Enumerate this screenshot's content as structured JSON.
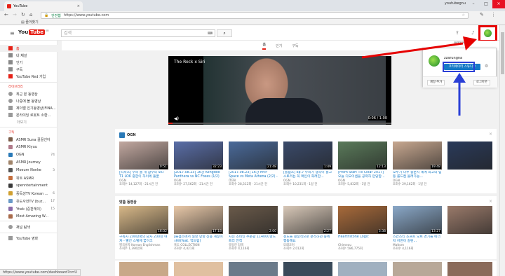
{
  "browser": {
    "tab_title": "YouTube",
    "user_label": "youtubegnu",
    "url_secure": "안전함",
    "url": "https://www.youtube.com",
    "bookmarks_label": "즐겨찾기"
  },
  "header": {
    "logo_you": "You",
    "logo_tube": "Tube",
    "logo_region": "KR",
    "search_placeholder": "검색",
    "keyboard_label": "⌨"
  },
  "tabs": [
    {
      "label": "홈"
    },
    {
      "label": "인기"
    },
    {
      "label": "구독"
    }
  ],
  "sidebar": {
    "items": [
      {
        "label": "홈",
        "color": "#e62117"
      },
      {
        "label": "내 채널",
        "color": "#888888"
      },
      {
        "label": "인기",
        "color": "#888888"
      },
      {
        "label": "구독",
        "color": "#888888"
      },
      {
        "label": "YouTube Red 가입",
        "color": "#e62117"
      }
    ],
    "library_header": "라이브러리",
    "library": [
      {
        "label": "최근 본 동영상"
      },
      {
        "label": "나중에 볼 동영상"
      },
      {
        "label": "제이벨 인기동영상(FINA..."
      },
      {
        "label": "몬라이딩 로봇트 소환..."
      }
    ],
    "library_more": "더보기",
    "subs_header": "구독",
    "subscriptions": [
      {
        "label": "ASMR Suna 꿀꿀선아",
        "count": "",
        "color": "#7a5c48"
      },
      {
        "label": "ASMR Kiyuu",
        "count": "",
        "color": "#b07a8a"
      },
      {
        "label": "OGN",
        "count": "74",
        "color": "#2a7ab8"
      },
      {
        "label": "ASMR Journey",
        "count": "",
        "color": "#a0846a"
      },
      {
        "label": "Moeum Nonke",
        "count": "3",
        "color": "#555555"
      },
      {
        "label": "위트 ASMR",
        "count": "",
        "color": "#c47040"
      },
      {
        "label": "spenntertainment",
        "count": "",
        "color": "#3a3a3a"
      },
      {
        "label": "중독성TV Korean ...",
        "count": "6",
        "color": "#d0a030"
      },
      {
        "label": "유도사전TV (buz...",
        "count": "17",
        "color": "#6a9ac8"
      },
      {
        "label": "Ytwk (중판계이)",
        "count": "15",
        "color": "#8a6aa8"
      },
      {
        "label": "Most Amazing W...",
        "count": "",
        "color": "#a86a4a"
      }
    ],
    "browse_channels": "채널 탐색",
    "movies": "YouTube 영화"
  },
  "player": {
    "title": "The Rock x Siri",
    "time": "0:06 / 1:00",
    "progress": 0.02
  },
  "ogn_section": {
    "title": "OGN",
    "cards": [
      {
        "title": "[티쳐스] 우리 둘 개 참우의 SKT T1 LOK 중한이 하이에 둘꿈",
        "channel": "OGN",
        "meta": "조회수 14,127회 · 21시간 전",
        "duration": "0:51",
        "color": "#c2a8a0"
      },
      {
        "title": "[2017.08.23] 16강 Kongdoo Panthera vs NC Foxes (1/2)",
        "channel": "OGN",
        "meta": "조회수 27,562회 · 21시간 전",
        "duration": "32:23",
        "color": "#5a6ea8"
      },
      {
        "title": "[2017.08.23] 16강 MVP Space vs Meta Athena (2/2) - 오버...",
        "channel": "OGN",
        "meta": "조회수 28,312회 · 21시간 전",
        "duration": "21:48",
        "color": "#4a6a9a"
      },
      {
        "title": "[롤챔스] Ep.7 우리가 생각이 들고스토리는 꼭 확인이 화려한...",
        "channel": "OGN",
        "meta": "조회수 10,231회 · 1일 전",
        "duration": "1:49",
        "color": "#3a4a6a"
      },
      {
        "title": "[From Start Till Clear 2017] 오늘 디오이셉을 공략하 만당합...",
        "channel": "OGN",
        "meta": "조회수 5,832회 · 1일 전",
        "duration": "12:13",
        "color": "#5a7a5a"
      },
      {
        "title": "오두기 다주 중분시 셰계 최고의 팀 등 롤드컵 몰려가능...",
        "channel": "OGN",
        "meta": "조회수 29,162회 · 1일 전",
        "duration": "19:48",
        "color": "#c8a890"
      },
      {
        "title": "",
        "channel": "",
        "meta": "",
        "duration": "",
        "color": "#2a3a5a"
      }
    ]
  },
  "rec_section": {
    "title": "맞춤 동영상",
    "cards": [
      {
        "title": "구독자 200만명의 남자 200만 여자 - 빨간 스텔에 꿈이크",
        "channel": "영국남자 Korean Englishman",
        "meta": "조회수 1,390만회",
        "duration": "16:02",
        "color": "#d8b888"
      },
      {
        "title": "[롤챔스에서 일할 망할 신용 계정이 사프(feat. 억드림)",
        "channel": "흑도 COLLECTION",
        "meta": "조회수 4,421회",
        "duration": "17:18",
        "color": "#e8c8a8"
      },
      {
        "title": "지신 소비인 주문광 114000골드 트리 전적",
        "channel": "유동인 탐색",
        "meta": "조회수 4,116회",
        "duration": "2:00",
        "color": "#6a5a4a"
      },
      {
        "title": "천도을 결정적으로 분석하던 중에 행동해요",
        "channel": "모레코이",
        "meta": "조회수 2,012회",
        "duration": "2:27",
        "color": "#d8c8b8"
      },
      {
        "title": "Hearthstone Logic",
        "channel": "Chimeou",
        "meta": "조회수 586,775회",
        "duration": "3:38",
        "color": "#a86a3a"
      },
      {
        "title": "스칸스티 소프트 오브 경기를 에너지 어떤이 갈린...",
        "channel": "Maltom",
        "meta": "조회수 4,116회",
        "duration": "13:27",
        "color": "#8aa8c8"
      },
      {
        "title": "",
        "channel": "",
        "meta": "",
        "duration": "",
        "color": "#9a7a6a"
      }
    ]
  },
  "popup": {
    "email": "@gmail.com",
    "name": "zzarungna",
    "studio_button": "크리에이터 스튜디오",
    "add_account": "계정 추가",
    "logout": "로그아웃"
  },
  "statusbar": "https://www.youtube.com/dashboard?o=U",
  "accent_colors": {
    "annotation_red": "#e60000",
    "annotation_blue": "#2a3fd6",
    "youtube_red": "#e62117"
  }
}
